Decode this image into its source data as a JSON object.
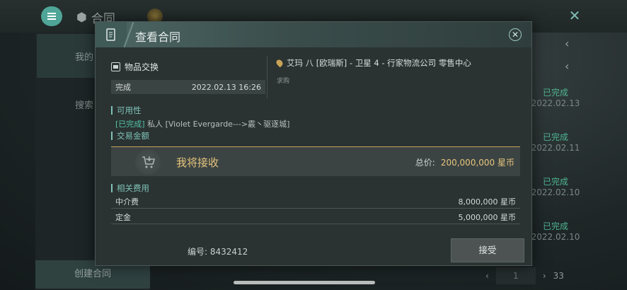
{
  "background": {
    "title": "合同",
    "close": "✕",
    "tabs": [
      "我的",
      "搜索"
    ],
    "create_button": "创建合同",
    "list": [
      {
        "status": "已完成",
        "date": "2022.02.13"
      },
      {
        "status": "已完成",
        "date": "2022.02.11"
      },
      {
        "status": "已完成",
        "date": "2022.02.10"
      },
      {
        "status": "已完成",
        "date": "2022.02.10"
      }
    ],
    "pager": {
      "prev": "‹",
      "page": "1",
      "next": "›",
      "total": "33"
    }
  },
  "modal": {
    "title": "查看合同",
    "close": "✕",
    "item_type": "物品交换",
    "status": "完成",
    "datetime": "2022.02.13 16:26",
    "location": "艾玛 八 [欧瑞斯] - 卫星 4 - 行家物流公司 零售中心",
    "location_sub": "求购",
    "availability_label": "可用性",
    "availability_status": "[已完成]",
    "availability_text": " 私人 [Violet Evergarde--->霰丶驱逐城]",
    "amount_label": "交易金额",
    "trade_label": "我将接收",
    "total_label": "总价:",
    "total_value": "200,000,000 星币",
    "fees_label": "相关费用",
    "fees": [
      {
        "name": "中介费",
        "value": "8,000,000 星币"
      },
      {
        "name": "定金",
        "value": "5,000,000 星币"
      }
    ],
    "contract_no": "编号: 8432412",
    "accept_button": "接受"
  },
  "colors": {
    "accent": "#7fc2b7",
    "gold": "#e6c57d",
    "done": "#55c4a6"
  }
}
